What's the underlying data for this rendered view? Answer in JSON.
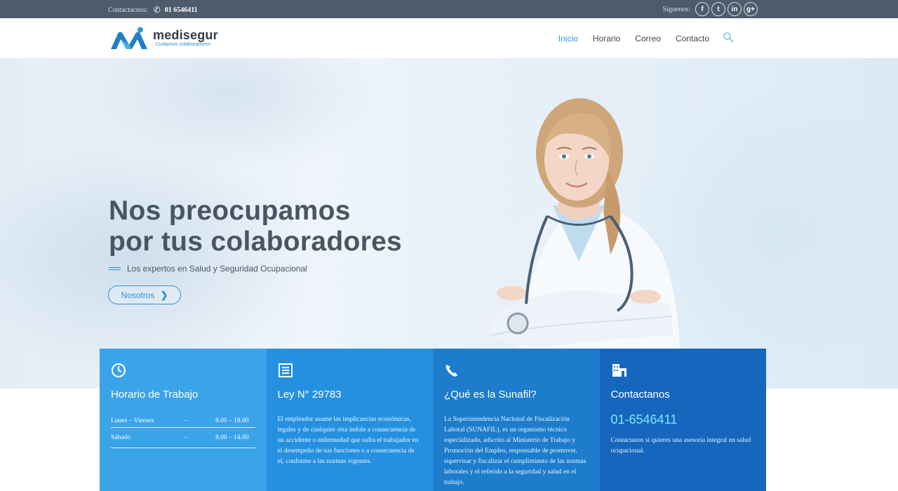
{
  "topbar": {
    "contact_label": "Contactacnos:",
    "phone": "01 6546411",
    "follow_label": "Siguenos:",
    "social": [
      {
        "icon": "facebook-icon",
        "glyph": "f"
      },
      {
        "icon": "twitter-icon",
        "glyph": "t"
      },
      {
        "icon": "linkedin-icon",
        "glyph": "in"
      },
      {
        "icon": "googleplus-icon",
        "glyph": "g+"
      }
    ]
  },
  "header": {
    "brand_name": "medisegur",
    "brand_tagline": "Cuidamos colaboradores",
    "nav": [
      {
        "label": "Inicio",
        "active": true
      },
      {
        "label": "Horario",
        "active": false
      },
      {
        "label": "Correo",
        "active": false
      },
      {
        "label": "Contacto",
        "active": false
      }
    ],
    "search_icon": "search-icon"
  },
  "hero": {
    "title_line1": "Nos preocupamos",
    "title_line2": "por tus colaboradores",
    "subtitle": "Los expertos en Salud y Seguridad Ocupacional",
    "button_label": "Nosotros",
    "button_icon": "chevron-right-icon"
  },
  "features": {
    "horario": {
      "icon": "clock-icon",
      "title": "Horario de Trabajo",
      "rows": [
        {
          "day": "Lunes – Viernes",
          "sep": "–",
          "hours": "8.00 – 18.00"
        },
        {
          "day": "Sábado",
          "sep": "–",
          "hours": "8.00 – 14.00"
        }
      ]
    },
    "ley": {
      "icon": "document-icon",
      "title": "Ley N° 29783",
      "text": "El empleador asume las implicancias económicas, legales y de cualquier otra índole a consecuencia de un accidente o enfermedad que sufra el trabajador en el desempeño de sus funciones o a consecuencia de el, conforme a las normas vigentes."
    },
    "sunafil": {
      "icon": "phone-icon",
      "title": "¿Qué es la Sunafil?",
      "text": "La Superintendencia Nacional de Fiscalización Laboral (SUNAFIL), es un organismo técnico especializado, adscrito al Ministerio de Trabajo y Promoción del Empleo, responsable de promover, supervisar y fiscalizar el cumplimiento de las normas laborales y el referido a la seguridad y salud en el trabajo."
    },
    "contacto": {
      "icon": "building-icon",
      "title": "Contactanos",
      "phone": "01-6546411",
      "text": "Contactanos si quieres una asesoría integral en salud ocupacional."
    }
  },
  "colors": {
    "topbar": "#4d5b6b",
    "accent": "#2c9ad8",
    "box1": "#3ba3e8",
    "box2": "#2590e0",
    "box3": "#1d7ccc",
    "box4": "#1566bd"
  }
}
